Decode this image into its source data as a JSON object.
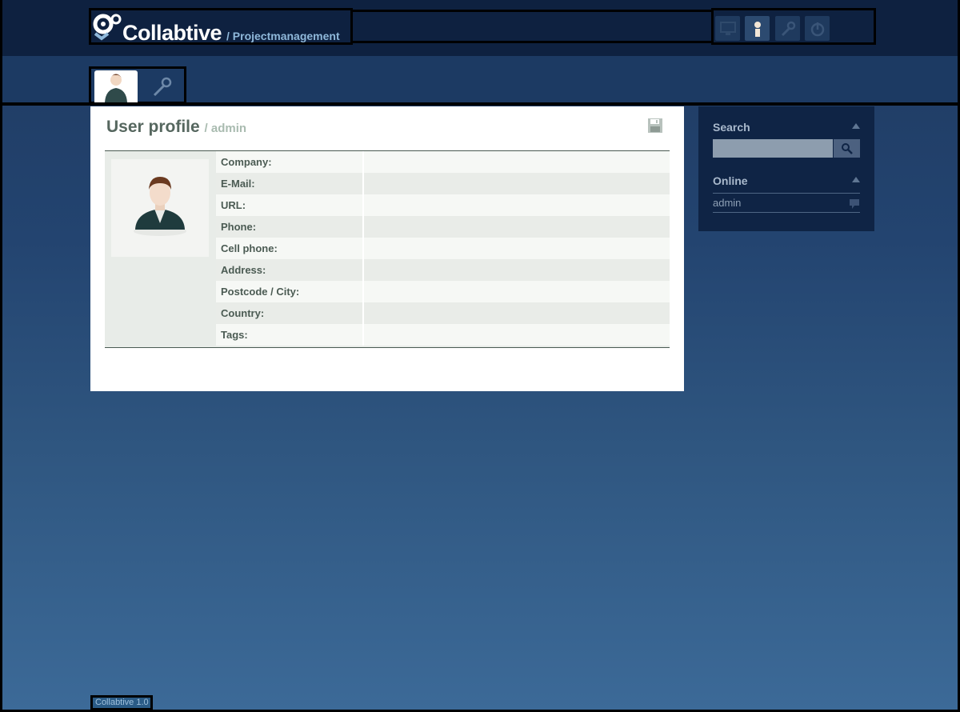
{
  "app": {
    "name": "Collabtive",
    "subtitle": "/ Projectmanagement",
    "version_footer": "Collabtive 1.0"
  },
  "top_nav": {
    "icons": [
      "desktop-icon",
      "user-icon",
      "wrench-icon",
      "power-icon"
    ]
  },
  "tabs": {
    "items": [
      "user-tab-icon",
      "wrench-tab-icon"
    ]
  },
  "profile": {
    "title": "User profile",
    "username": "/ admin",
    "fields": [
      {
        "label": "Company:",
        "value": ""
      },
      {
        "label": "E-Mail:",
        "value": ""
      },
      {
        "label": "URL:",
        "value": ""
      },
      {
        "label": "Phone:",
        "value": ""
      },
      {
        "label": "Cell phone:",
        "value": ""
      },
      {
        "label": "Address:",
        "value": ""
      },
      {
        "label": "Postcode / City:",
        "value": ""
      },
      {
        "label": "Country:",
        "value": ""
      },
      {
        "label": "Tags:",
        "value": ""
      }
    ]
  },
  "sidebar": {
    "search": {
      "title": "Search",
      "placeholder": ""
    },
    "online": {
      "title": "Online",
      "users": [
        "admin"
      ]
    }
  },
  "colors": {
    "header_bg": "#0e2140",
    "accent": "#8fb8da",
    "content_bg": "#ffffff"
  }
}
